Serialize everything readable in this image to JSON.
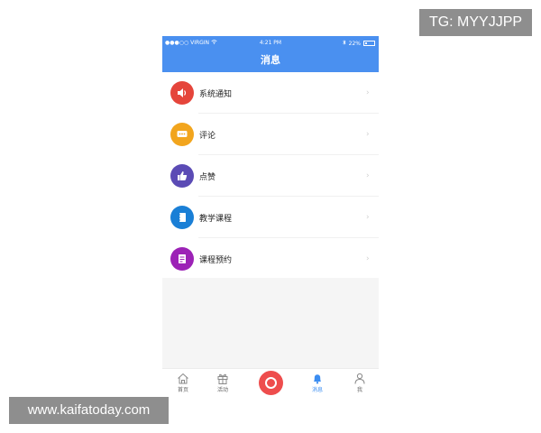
{
  "watermark_top": "TG: MYYJJPP",
  "watermark_bottom": "www.kaifatoday.com",
  "status_bar": {
    "carrier": "●●●○○ VIRGIN",
    "time": "4:21 PM",
    "battery": "22%",
    "battery_level": 0.22
  },
  "nav": {
    "title": "消息"
  },
  "list": [
    {
      "label": "系统通知",
      "icon": "speaker-icon",
      "color": "#e5453b"
    },
    {
      "label": "评论",
      "icon": "comment-icon",
      "color": "#f2a51d"
    },
    {
      "label": "点赞",
      "icon": "thumbs-up-icon",
      "color": "#5b4bb5"
    },
    {
      "label": "教学课程",
      "icon": "book-icon",
      "color": "#1a7fd6"
    },
    {
      "label": "课程预约",
      "icon": "calendar-icon",
      "color": "#9c22b6"
    }
  ],
  "tabs": [
    {
      "label": "首页",
      "icon": "home-icon"
    },
    {
      "label": "活动",
      "icon": "gift-icon"
    },
    {
      "label": "消息",
      "icon": "bell-icon",
      "active": true
    },
    {
      "label": "我",
      "icon": "user-icon"
    }
  ],
  "colors": {
    "nav_bg": "#4a90f0",
    "accent": "#3b8df1",
    "center_button": "#ee4d4d"
  }
}
